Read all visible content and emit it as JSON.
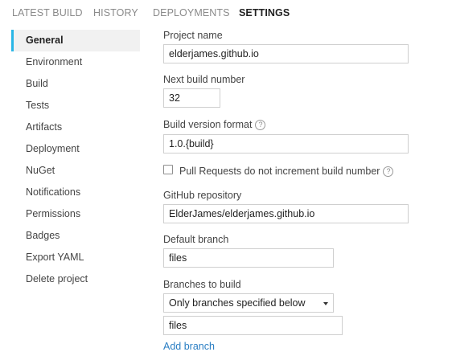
{
  "tabs": [
    {
      "label": "LATEST BUILD"
    },
    {
      "label": "HISTORY"
    },
    {
      "label": "DEPLOYMENTS"
    },
    {
      "label": "SETTINGS",
      "active": true
    }
  ],
  "sidebar": {
    "items": [
      {
        "label": "General",
        "active": true
      },
      {
        "label": "Environment"
      },
      {
        "label": "Build"
      },
      {
        "label": "Tests"
      },
      {
        "label": "Artifacts"
      },
      {
        "label": "Deployment"
      },
      {
        "label": "NuGet"
      },
      {
        "label": "Notifications"
      },
      {
        "label": "Permissions"
      },
      {
        "label": "Badges"
      },
      {
        "label": "Export YAML"
      },
      {
        "label": "Delete project"
      }
    ]
  },
  "form": {
    "project_name": {
      "label": "Project name",
      "value": "elderjames.github.io"
    },
    "next_build_number": {
      "label": "Next build number",
      "value": "32"
    },
    "build_version_format": {
      "label": "Build version format",
      "value": "1.0.{build}",
      "help_icon": "question-circle-icon"
    },
    "pull_requests": {
      "label": "Pull Requests do not increment build number",
      "checked": false,
      "help_icon": "question-circle-icon"
    },
    "github_repository": {
      "label": "GitHub repository",
      "value": "ElderJames/elderjames.github.io"
    },
    "default_branch": {
      "label": "Default branch",
      "value": "files"
    },
    "branches_to_build": {
      "label": "Branches to build",
      "selected": "Only branches specified below",
      "branch_value": "files",
      "add_branch_label": "Add branch"
    }
  },
  "colors": {
    "accent": "#29b6e6",
    "link": "#2a7ec3",
    "active_tab": "#222222",
    "inactive_tab": "#8a8a8a"
  }
}
